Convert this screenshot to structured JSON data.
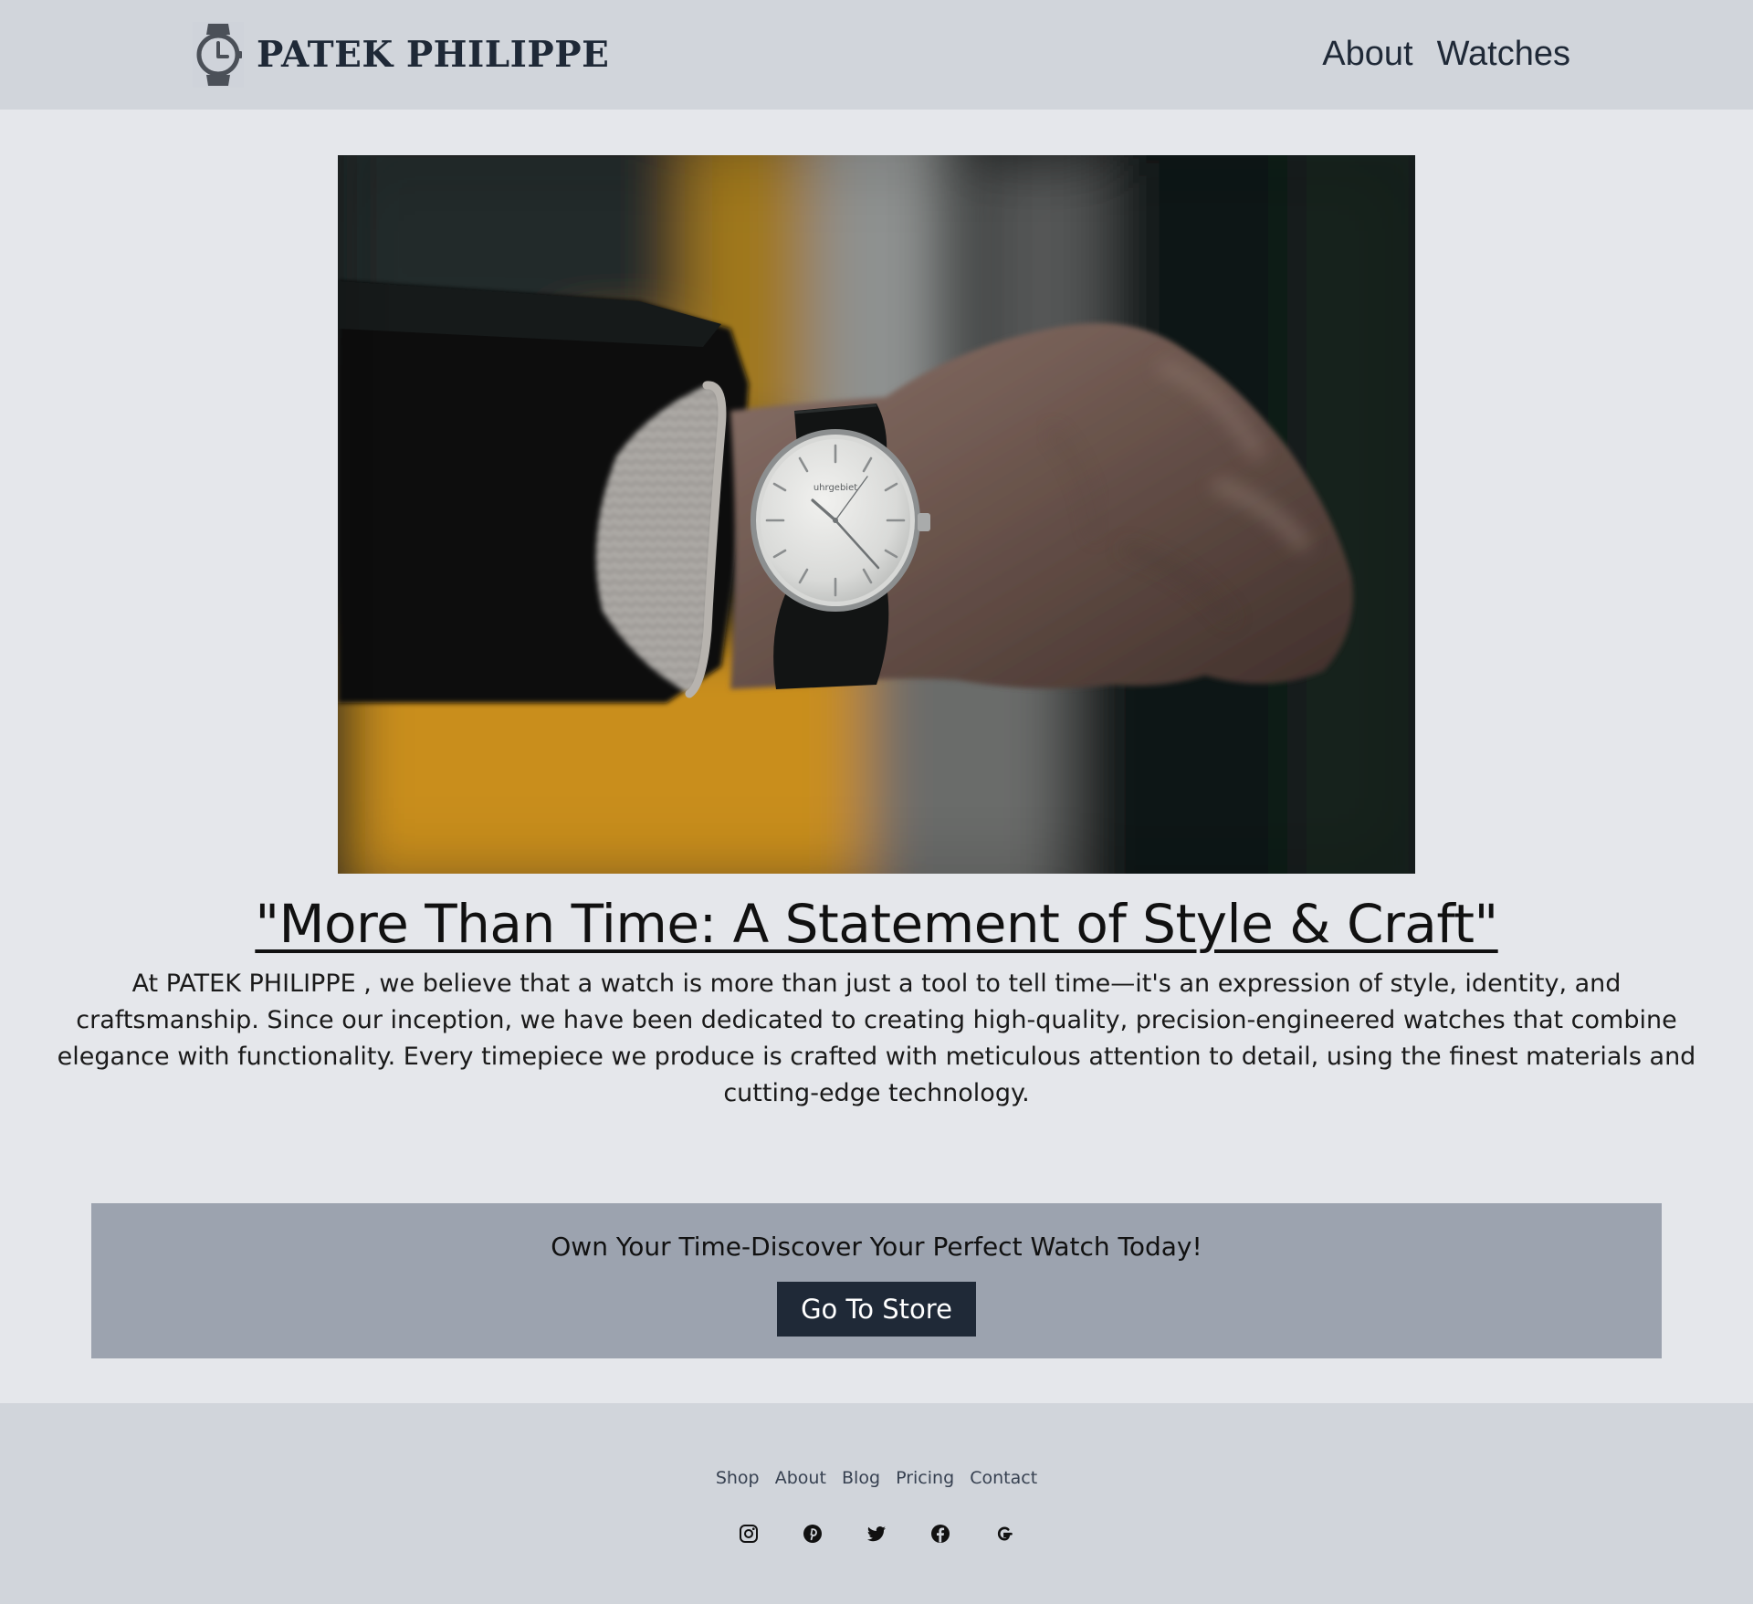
{
  "header": {
    "brand_name": "PATEK PHILIPPE",
    "nav": [
      "About",
      "Watches"
    ]
  },
  "hero": {
    "image_alt": "Hand wearing a silver wristwatch with a white dial",
    "dial_text": "uhrgebiet",
    "title": "\"More Than Time: A Statement of Style & Craft\"",
    "body": "At PATEK PHILIPPE , we believe that a watch is more than just a tool to tell time—it's an expression of style, identity, and craftsmanship. Since our inception, we have been dedicated to creating high-quality, precision-engineered watches that combine elegance with functionality. Every timepiece we produce is crafted with meticulous attention to detail, using the finest materials and cutting-edge technology."
  },
  "cta": {
    "heading": "Own Your Time-Discover Your Perfect Watch Today!",
    "button_label": "Go To Store"
  },
  "footer": {
    "links": [
      "Shop",
      "About",
      "Blog",
      "Pricing",
      "Contact"
    ],
    "social_icons": [
      "instagram-icon",
      "pinterest-icon",
      "twitter-icon",
      "facebook-icon",
      "google-icon"
    ]
  },
  "colors": {
    "header_bg": "#d1d5db",
    "page_bg": "#e5e7eb",
    "cta_bg": "#9ca3af",
    "button_bg": "#1f2937",
    "footer_bg": "#d1d5db",
    "text_dark": "#1f2937"
  }
}
